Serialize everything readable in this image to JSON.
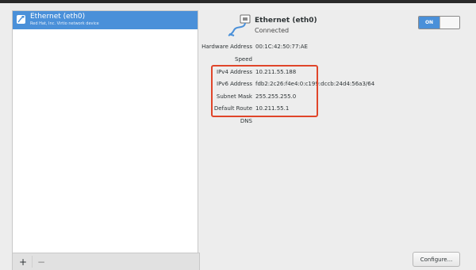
{
  "device_list": {
    "items": [
      {
        "name": "Ethernet (eth0)",
        "description": "Red Hat, Inc. Virtio network device"
      }
    ],
    "add_label": "+",
    "remove_label": "−"
  },
  "connection": {
    "title": "Ethernet (eth0)",
    "status": "Connected",
    "toggle_label": "ON",
    "toggle_state": "on"
  },
  "details": {
    "hardware_address": {
      "label": "Hardware Address",
      "value": "00:1C:42:50:77:AE"
    },
    "speed": {
      "label": "Speed",
      "value": ""
    },
    "ipv4": {
      "label": "IPv4 Address",
      "value": "10.211.55.188"
    },
    "ipv6": {
      "label": "IPv6 Address",
      "value": "fdb2:2c26:f4e4:0:c199:dccb:24d4:56a3/64"
    },
    "subnet": {
      "label": "Subnet Mask",
      "value": "255.255.255.0"
    },
    "route": {
      "label": "Default Route",
      "value": "10.211.55.1"
    },
    "dns": {
      "label": "DNS",
      "value": ""
    }
  },
  "configure_label": "Configure...",
  "colors": {
    "accent": "#4a90d9",
    "highlight_box": "#e0452a",
    "background": "#ededed"
  }
}
